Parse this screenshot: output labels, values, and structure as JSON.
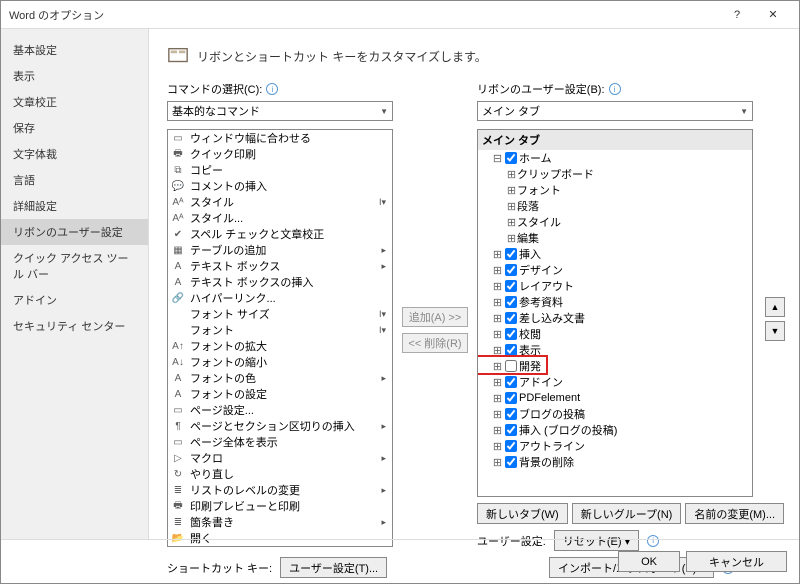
{
  "window": {
    "title": "Word のオプション",
    "help": "?",
    "close": "✕"
  },
  "sidebar": {
    "items": [
      "基本設定",
      "表示",
      "文章校正",
      "保存",
      "文字体裁",
      "言語",
      "詳細設定",
      "リボンのユーザー設定",
      "クイック アクセス ツール バー",
      "アドイン",
      "セキュリティ センター"
    ],
    "selected_index": 7
  },
  "header": {
    "title": "リボンとショートカット キーをカスタマイズします。"
  },
  "left": {
    "label": "コマンドの選択(C): ",
    "dropdown": "基本的なコマンド",
    "commands": [
      {
        "t": "ウィンドウ幅に合わせる",
        "i": "▭"
      },
      {
        "t": "クイック印刷",
        "i": "🖶"
      },
      {
        "t": "コピー",
        "i": "⧉"
      },
      {
        "t": "コメントの挿入",
        "i": "💬"
      },
      {
        "t": "スタイル",
        "i": "Aᴬ",
        "a": true
      },
      {
        "t": "スタイル...",
        "i": "Aᴬ"
      },
      {
        "t": "スペル チェックと文章校正",
        "i": "✔"
      },
      {
        "t": "テーブルの追加",
        "i": "▦",
        "r": true
      },
      {
        "t": "テキスト ボックス",
        "i": "A",
        "r": true
      },
      {
        "t": "テキスト ボックスの挿入",
        "i": "A"
      },
      {
        "t": "ハイパーリンク...",
        "i": "🔗"
      },
      {
        "t": "フォント サイズ",
        "i": " ",
        "a": true
      },
      {
        "t": "フォント",
        "i": " ",
        "a": true
      },
      {
        "t": "フォントの拡大",
        "i": "A↑"
      },
      {
        "t": "フォントの縮小",
        "i": "A↓"
      },
      {
        "t": "フォントの色",
        "i": "A",
        "r": true
      },
      {
        "t": "フォントの設定",
        "i": "A"
      },
      {
        "t": "ページ設定...",
        "i": "▭"
      },
      {
        "t": "ページとセクション区切りの挿入",
        "i": "¶",
        "r": true
      },
      {
        "t": "ページ全体を表示",
        "i": "▭"
      },
      {
        "t": "マクロ",
        "i": "▷",
        "r": true
      },
      {
        "t": "やり直し",
        "i": "↻"
      },
      {
        "t": "リストのレベルの変更",
        "i": "≣",
        "r": true
      },
      {
        "t": "印刷プレビューと印刷",
        "i": "🖶"
      },
      {
        "t": "箇条書き",
        "i": "≣",
        "r": true
      },
      {
        "t": "開く",
        "i": "📂"
      }
    ]
  },
  "mid": {
    "add": "追加(A) >>",
    "remove": "<< 削除(R)"
  },
  "right": {
    "label": "リボンのユーザー設定(B): ",
    "dropdown": "メイン タブ",
    "header": "メイン タブ",
    "tree": [
      {
        "d": 1,
        "e": "-",
        "c": true,
        "t": "ホーム"
      },
      {
        "d": 2,
        "e": "+",
        "t": "クリップボード"
      },
      {
        "d": 2,
        "e": "+",
        "t": "フォント"
      },
      {
        "d": 2,
        "e": "+",
        "t": "段落"
      },
      {
        "d": 2,
        "e": "+",
        "t": "スタイル"
      },
      {
        "d": 2,
        "e": "+",
        "t": "編集"
      },
      {
        "d": 1,
        "e": "+",
        "c": true,
        "t": "挿入"
      },
      {
        "d": 1,
        "e": "+",
        "c": true,
        "t": "デザイン"
      },
      {
        "d": 1,
        "e": "+",
        "c": true,
        "t": "レイアウト"
      },
      {
        "d": 1,
        "e": "+",
        "c": true,
        "t": "参考資料"
      },
      {
        "d": 1,
        "e": "+",
        "c": true,
        "t": "差し込み文書"
      },
      {
        "d": 1,
        "e": "+",
        "c": true,
        "t": "校閲"
      },
      {
        "d": 1,
        "e": "+",
        "c": true,
        "t": "表示"
      },
      {
        "d": 1,
        "e": "+",
        "c": false,
        "t": "開発",
        "hl": true
      },
      {
        "d": 1,
        "e": "+",
        "c": true,
        "t": "アドイン"
      },
      {
        "d": 1,
        "e": "+",
        "c": true,
        "t": "PDFelement"
      },
      {
        "d": 1,
        "e": "+",
        "c": true,
        "t": "ブログの投稿"
      },
      {
        "d": 1,
        "e": "+",
        "c": true,
        "t": "挿入 (ブログの投稿)"
      },
      {
        "d": 1,
        "e": "+",
        "c": true,
        "t": "アウトライン"
      },
      {
        "d": 1,
        "e": "+",
        "c": true,
        "t": "背景の削除"
      }
    ],
    "buttons": {
      "newtab": "新しいタブ(W)",
      "newgroup": "新しいグループ(N)",
      "rename": "名前の変更(M)..."
    },
    "user_setting_label": "ユーザー設定:",
    "reset": "リセット(E) ▾",
    "import": "インポート/エクスポート(P) ▾"
  },
  "shortcut": {
    "label": "ショートカット キー:",
    "btn": "ユーザー設定(T)..."
  },
  "footer": {
    "ok": "OK",
    "cancel": "キャンセル"
  },
  "updown": {
    "up": "▲",
    "down": "▼"
  }
}
